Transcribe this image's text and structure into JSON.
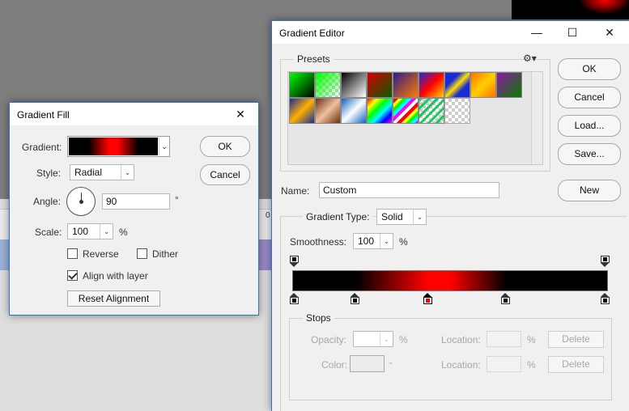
{
  "gradient_fill": {
    "title": "Gradient Fill",
    "gradient_label": "Gradient:",
    "style_label": "Style:",
    "style_value": "Radial",
    "angle_label": "Angle:",
    "angle_value": "90",
    "angle_unit": "°",
    "scale_label": "Scale:",
    "scale_value": "100",
    "scale_unit": "%",
    "reverse_label": "Reverse",
    "dither_label": "Dither",
    "align_label": "Align with layer",
    "reset_label": "Reset Alignment",
    "ok_label": "OK",
    "cancel_label": "Cancel"
  },
  "gradient_editor": {
    "title": "Gradient Editor",
    "presets_label": "Presets",
    "ok_label": "OK",
    "cancel_label": "Cancel",
    "load_label": "Load...",
    "save_label": "Save...",
    "name_label": "Name:",
    "name_value": "Custom",
    "new_label": "New",
    "gradient_type_label": "Gradient Type:",
    "gradient_type_value": "Solid",
    "smoothness_label": "Smoothness:",
    "smoothness_value": "100",
    "smoothness_unit": "%",
    "stops_label": "Stops",
    "opacity_label": "Opacity:",
    "opacity_unit": "%",
    "color_label": "Color:",
    "location_label": "Location:",
    "location_unit": "%",
    "delete_label": "Delete"
  },
  "bg_ruler_digit": "0",
  "colors": {
    "accent_border": "#2b75c9",
    "stop_selected": "#ff0000"
  }
}
